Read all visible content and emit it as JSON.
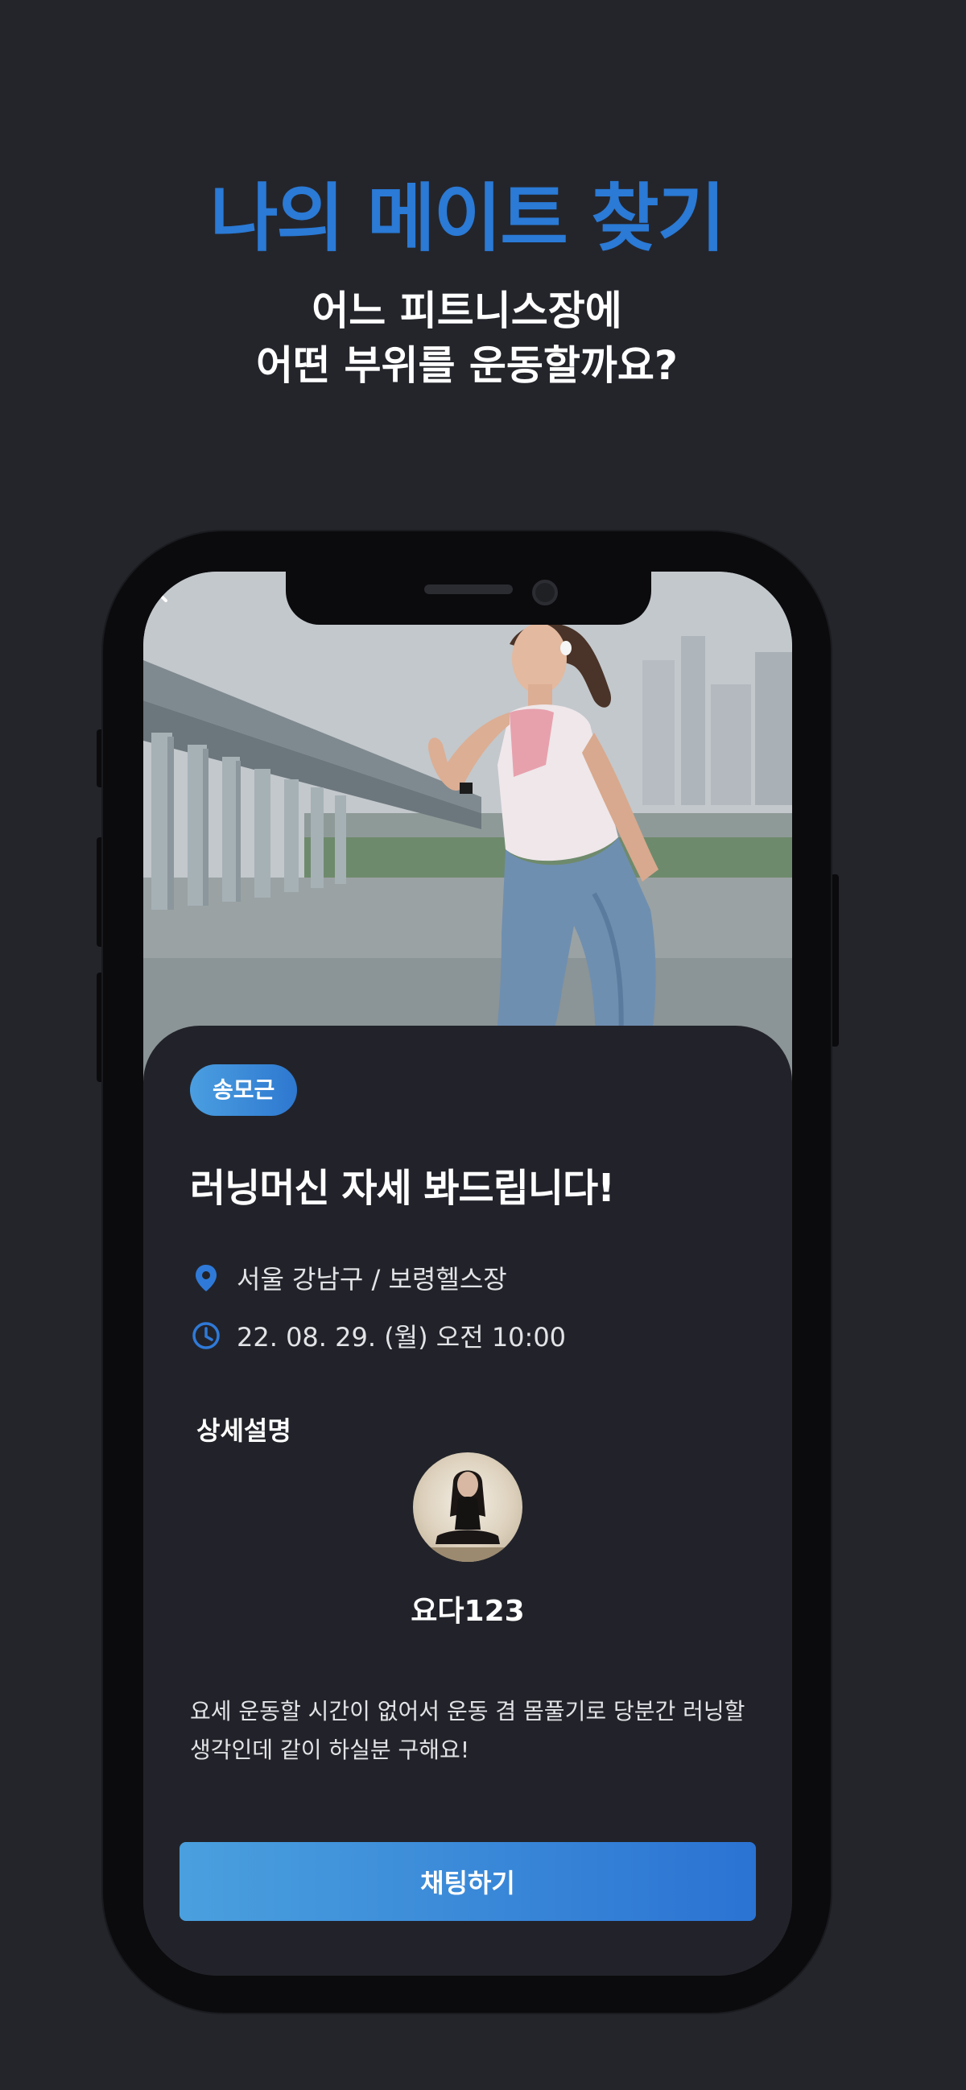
{
  "promo": {
    "title": "나의 메이트 찾기",
    "subtitle_line1": "어느 피트니스장에",
    "subtitle_line2": "어떤 부위를 운동할까요?"
  },
  "post": {
    "badge": "송모근",
    "title": "러닝머신 자세 봐드립니다!",
    "location": "서울 강남구 / 보령헬스장",
    "datetime": "22. 08. 29. (월) 오전 10:00",
    "section_label": "상세설명",
    "author": "요다123",
    "description": "요세 운동할 시간이 없어서 운동 겸 몸풀기로 당분간 러닝할 생각인데 같이 하실분 구해요!",
    "chat_button": "채팅하기"
  },
  "icons": {
    "back": "chevron-left-icon",
    "location": "map-pin-icon",
    "time": "clock-icon"
  },
  "colors": {
    "background": "#24252b",
    "accent": "#2a7ad6",
    "card": "#22232a",
    "text": "#ffffff"
  }
}
